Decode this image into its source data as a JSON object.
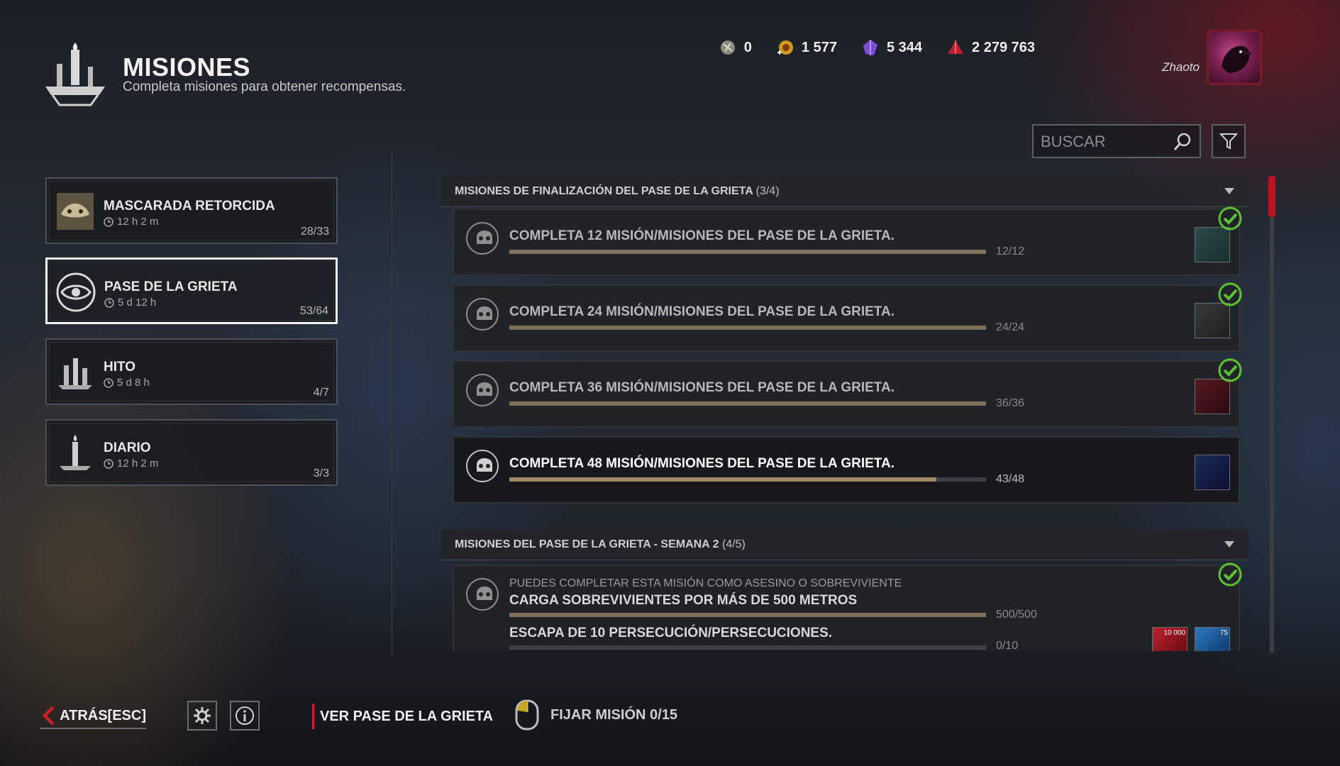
{
  "header": {
    "title": "MISIONES",
    "subtitle": "Completa misiones para obtener recompensas.",
    "logo_icon": "candle-icon"
  },
  "currencies": [
    {
      "icon": "rift-fragment-icon",
      "value": "0"
    },
    {
      "icon": "bloodpoints-icon",
      "value": "1 577"
    },
    {
      "icon": "auric-cells-icon",
      "value": "5 344"
    },
    {
      "icon": "iridescent-shards-icon",
      "value": "2 279 763"
    }
  ],
  "user": {
    "name": "Zhaoto",
    "avatar_icon": "raven-avatar-icon"
  },
  "search": {
    "placeholder": "BUSCAR"
  },
  "categories": [
    {
      "name": "MASCARADA RETORCIDA",
      "time": "12 h 2 m",
      "count": "28/33",
      "active": false
    },
    {
      "name": "PASE DE LA GRIETA",
      "time": "5 d 12 h",
      "count": "53/64",
      "active": true
    },
    {
      "name": "HITO",
      "time": "5 d 8 h",
      "count": "4/7",
      "active": false
    },
    {
      "name": "DIARIO",
      "time": "12 h 2 m",
      "count": "3/3",
      "active": false
    }
  ],
  "groups": [
    {
      "title": "MISIONES DE FINALIZACIÓN DEL PASE DE LA GRIETA",
      "count": "(3/4)",
      "missions": [
        {
          "title": "COMPLETA 12 MISIÓN/MISIONES DEL PASE DE LA GRIETA.",
          "progress": "12/12",
          "fraction": 1.0,
          "completed": true
        },
        {
          "title": "COMPLETA 24 MISIÓN/MISIONES DEL PASE DE LA GRIETA.",
          "progress": "24/24",
          "fraction": 1.0,
          "completed": true
        },
        {
          "title": "COMPLETA 36 MISIÓN/MISIONES DEL PASE DE LA GRIETA.",
          "progress": "36/36",
          "fraction": 1.0,
          "completed": true
        },
        {
          "title": "COMPLETA 48 MISIÓN/MISIONES DEL PASE DE LA GRIETA.",
          "progress": "43/48",
          "fraction": 0.896,
          "completed": false
        }
      ]
    },
    {
      "title": "MISIONES DEL PASE DE LA GRIETA - SEMANA 2",
      "count": "(4/5)",
      "missions": [
        {
          "note": "PUEDES COMPLETAR ESTA MISIÓN COMO ASESINO O SOBREVIVIENTE",
          "objectives": [
            {
              "title": "CARGA SOBREVIVIENTES POR MÁS DE 500 METROS",
              "progress": "500/500",
              "fraction": 1.0
            },
            {
              "title": "ESCAPA DE 10 PERSECUCIÓN/PERSECUCIONES.",
              "progress": "0/10",
              "fraction": 0.0
            }
          ],
          "rewards": [
            "10 000",
            "75"
          ],
          "completed": true
        }
      ]
    }
  ],
  "footer": {
    "back_label": "ATRÁS",
    "back_key": "[ESC]",
    "view_pass_label": "VER PASE DE LA GRIETA",
    "pin_label": "FIJAR MISIÓN 0/15"
  },
  "colors": {
    "accent_red": "#c1121f",
    "progress_fill": "#a08a66",
    "check_green": "#5cc22e"
  }
}
